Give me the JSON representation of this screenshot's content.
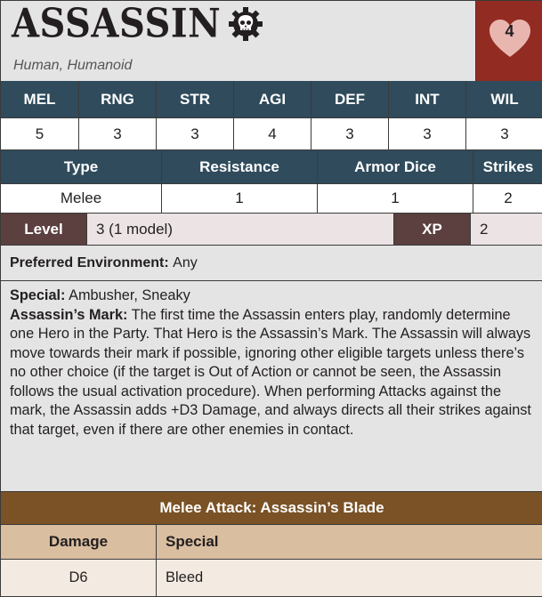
{
  "header": {
    "title": "ASSASSIN",
    "subtitle": "Human, Humanoid",
    "health": "4"
  },
  "stats": {
    "labels": [
      "MEL",
      "RNG",
      "STR",
      "AGI",
      "DEF",
      "INT",
      "WIL"
    ],
    "values": [
      "5",
      "3",
      "3",
      "4",
      "3",
      "3",
      "3"
    ]
  },
  "info": {
    "labels": [
      "Type",
      "Resistance",
      "Armor Dice",
      "Strikes"
    ],
    "values": [
      "Melee",
      "1",
      "1",
      "2"
    ]
  },
  "level": {
    "label": "Level",
    "value": "3 (1 model)",
    "xp_label": "XP",
    "xp_value": "2"
  },
  "preferred": {
    "label": "Preferred Environment:",
    "value": "Any"
  },
  "special": {
    "label": "Special:",
    "value": "Ambusher, Sneaky",
    "mark_label": "Assassin’s Mark:",
    "mark_text": "The first time the Assassin enters play, randomly determine one Hero in the Party. That Hero is the Assassin’s Mark. The Assassin will always move towards their mark if possible, ignoring other eligible targets unless there’s no other choice (if the target is Out of Action or cannot be seen, the Assassin follows the usual activation procedure). When performing Attacks against the mark, the Assassin adds +D3 Damage, and always directs all their strikes against that target, even if there are other enemies in contact."
  },
  "attack": {
    "title": "Melee Attack: Assassin’s Blade",
    "damage_label": "Damage",
    "special_label": "Special",
    "damage_value": "D6",
    "special_value": "Bleed"
  },
  "colors": {
    "stat_header": "#2f4b5c",
    "heart_box": "#922b21",
    "level_label": "#5c3f3f",
    "attack_header": "#7a5225",
    "damage_header": "#d9bea0"
  },
  "icons": [
    "skull-gear-icon",
    "heart-icon"
  ]
}
